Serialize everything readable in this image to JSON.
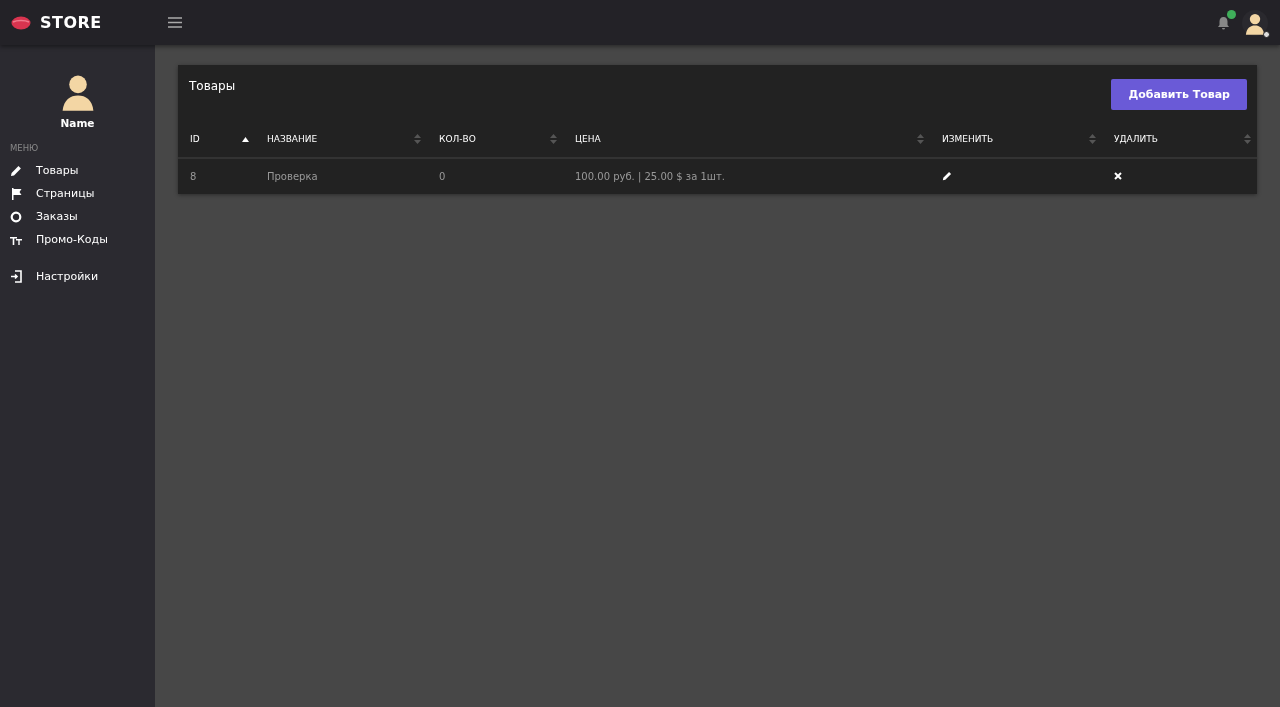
{
  "brand": {
    "title": "STORE"
  },
  "user": {
    "name": "Name"
  },
  "menu": {
    "heading": "МЕНЮ",
    "items": [
      {
        "label": "Товары"
      },
      {
        "label": "Страницы"
      },
      {
        "label": "Заказы"
      },
      {
        "label": "Промо-Коды"
      }
    ],
    "footer_items": [
      {
        "label": "Настройки"
      }
    ]
  },
  "card": {
    "title": "Товары",
    "add_button": "Добавить Товар"
  },
  "table": {
    "columns": [
      {
        "label": "ID",
        "sorted": true
      },
      {
        "label": "НАЗВАНИЕ",
        "sorted": false
      },
      {
        "label": "КОЛ-ВО",
        "sorted": false
      },
      {
        "label": "ЦЕНА",
        "sorted": false
      },
      {
        "label": "ИЗМЕНИТЬ",
        "sorted": false
      },
      {
        "label": "УДАЛИТЬ",
        "sorted": false
      }
    ],
    "rows": [
      {
        "cells": [
          {
            "kind": "text",
            "text": "8"
          },
          {
            "kind": "text",
            "text": "Проверка"
          },
          {
            "kind": "text",
            "text": "0"
          },
          {
            "kind": "text",
            "text": "100.00 руб. | 25.00 $ за 1шт."
          },
          {
            "kind": "edit"
          },
          {
            "kind": "delete"
          }
        ]
      }
    ]
  }
}
